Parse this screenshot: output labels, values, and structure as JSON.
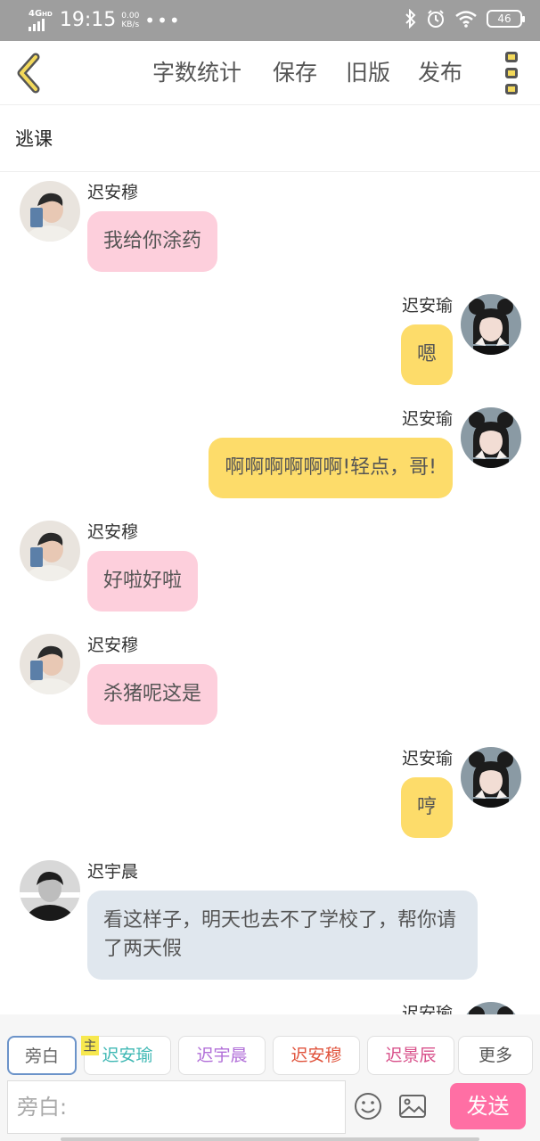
{
  "status_bar": {
    "network": "4G",
    "network_sup": "HD",
    "time": "19:15",
    "speed_value": "0.00",
    "speed_unit": "KB/s",
    "more_dots": "•••",
    "battery": "46"
  },
  "toolbar": {
    "word_count": "字数统计",
    "save": "保存",
    "old_version": "旧版",
    "publish": "发布"
  },
  "story": {
    "title": "逃课"
  },
  "messages": [
    {
      "side": "left",
      "name": "迟安穆",
      "text": "我给你涂药",
      "color": "pink",
      "avatar": "boy-phone"
    },
    {
      "side": "right",
      "name": "迟安瑜",
      "text": "嗯",
      "color": "yellow",
      "avatar": "girl-buns"
    },
    {
      "side": "right",
      "name": "迟安瑜",
      "text": "啊啊啊啊啊啊!轻点，哥!",
      "color": "yellow",
      "avatar": "girl-buns"
    },
    {
      "side": "left",
      "name": "迟安穆",
      "text": "好啦好啦",
      "color": "pink",
      "avatar": "boy-phone"
    },
    {
      "side": "left",
      "name": "迟安穆",
      "text": "杀猪呢这是",
      "color": "pink",
      "avatar": "boy-phone"
    },
    {
      "side": "right",
      "name": "迟安瑜",
      "text": "哼",
      "color": "yellow",
      "avatar": "girl-buns"
    },
    {
      "side": "left",
      "name": "迟宇晨",
      "text": "看这样子，明天也去不了学校了，帮你请了两天假",
      "color": "blue",
      "avatar": "boy-dark"
    },
    {
      "side": "right",
      "name": "迟安瑜",
      "text": "",
      "color": "yellow",
      "avatar": "girl-buns"
    }
  ],
  "roles": [
    {
      "label": "旁白",
      "color": "#666666"
    },
    {
      "label": "迟安瑜",
      "color": "#3fb8b4"
    },
    {
      "label": "迟宇晨",
      "color": "#b16fd8"
    },
    {
      "label": "迟安穆",
      "color": "#e0533c"
    },
    {
      "label": "迟景辰",
      "color": "#d8508a"
    },
    {
      "label": "更多",
      "color": "#555555"
    }
  ],
  "master_tag": "主",
  "composer": {
    "placeholder": "旁白:",
    "send": "发送"
  },
  "colors": {
    "pink_bubble": "#fdcfdc",
    "yellow_bubble": "#fddc6a",
    "blue_bubble": "#e0e7ee",
    "send_button": "#ff6fa4",
    "menu_accent": "#f3d95a"
  }
}
